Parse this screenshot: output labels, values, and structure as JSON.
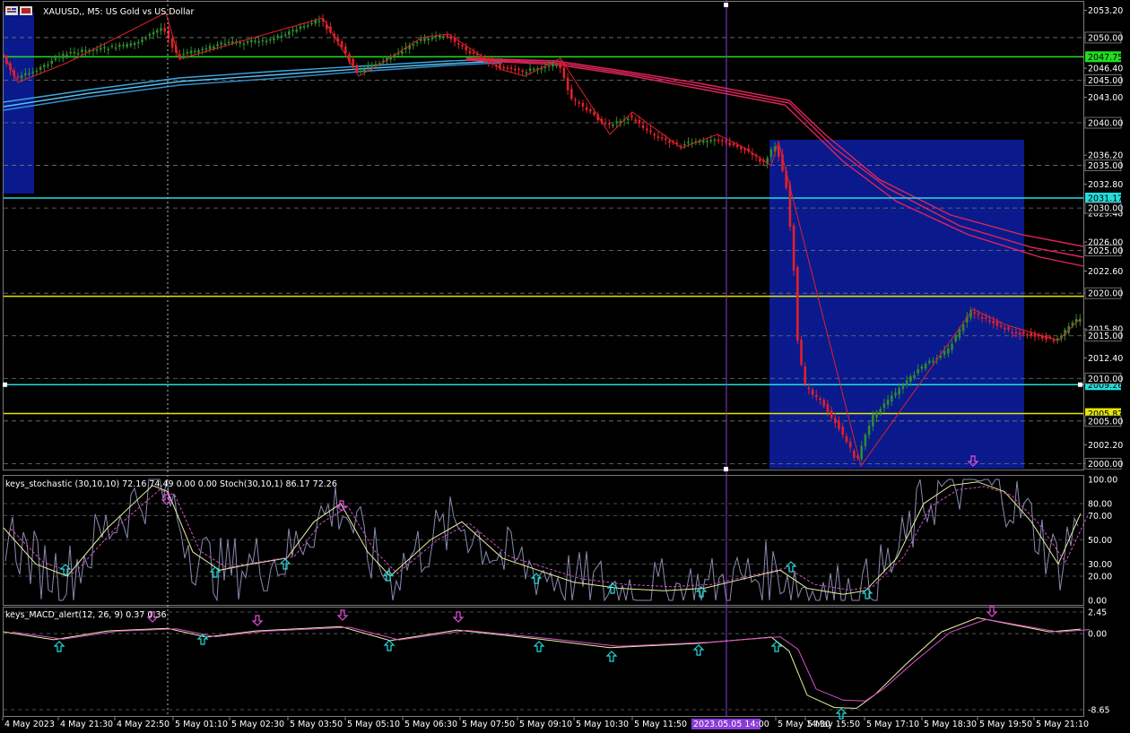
{
  "title": "XAUUSD,, M5:  US Gold vs US Dollar",
  "colors": {
    "background": "#000000",
    "bull": "#2e8b2e",
    "bear": "#e0202a",
    "zone": "#0a1a8c",
    "ema_red": "#e0245a",
    "ema_blue": "#3aa8e0",
    "green_level": "#22dd22",
    "cyan_level": "#22dddd",
    "yellow_level": "#e6e600",
    "crosshair": "#8a3ad8"
  },
  "price_axis": {
    "range": [
      1999.3,
      2054.2
    ],
    "ticks": [
      "2053.20",
      "2050.00",
      "2046.40",
      "2045.00",
      "2043.00",
      "2040.00",
      "2036.20",
      "2035.00",
      "2032.80",
      "2029.40",
      "2026.00",
      "2025.00",
      "2022.60",
      "2020.00",
      "2015.80",
      "2015.00",
      "2012.40",
      "2010.00",
      "2005.00",
      "2002.20",
      "2000.00"
    ],
    "tick_values": [
      2053.2,
      2050.0,
      2046.4,
      2045.0,
      2043.0,
      2040.0,
      2036.2,
      2035.0,
      2032.8,
      2029.4,
      2026.0,
      2025.0,
      2022.6,
      2020.0,
      2015.8,
      2015.0,
      2012.4,
      2010.0,
      2005.0,
      2002.2,
      2000.0
    ],
    "boxed": [
      "2050.00",
      "2045.00",
      "2040.00",
      "2035.00",
      "2030.00",
      "2025.00",
      "2020.00",
      "2015.00",
      "2010.00",
      "2005.00",
      "2000.00"
    ],
    "boxed_values": [
      2050,
      2045,
      2040,
      2035,
      2030,
      2025,
      2020,
      2015,
      2010,
      2005,
      2000
    ]
  },
  "levels": [
    {
      "value": 2047.75,
      "label": "2047.75",
      "color": "#22dd22",
      "text": "#000000"
    },
    {
      "value": 2031.17,
      "label": "2031.17",
      "color": "#22dddd",
      "text": "#000000"
    },
    {
      "value": 2019.64,
      "label": "",
      "color": "#e6e600",
      "text": "#000000"
    },
    {
      "value": 2009.26,
      "label": "2009.26",
      "color": "#22dddd",
      "text": "#000000"
    },
    {
      "value": 2005.87,
      "label": "2005.87",
      "color": "#e6e600",
      "text": "#000000"
    }
  ],
  "stochastic": {
    "label": "keys_stochastic (30,10,10) 72.16 74.49 0.00 0.00 Stoch(30,10,1) 86.17 72.26",
    "ticks": [
      "100.00",
      "80.00",
      "70.00",
      "50.00",
      "30.00",
      "20.00",
      "0.00"
    ],
    "tick_values": [
      100,
      80,
      70,
      50,
      30,
      20,
      0
    ]
  },
  "macd": {
    "label": "keys_MACD_alert(12, 26, 9) 0.37 0.36",
    "ticks": [
      "2.45",
      "0.00",
      "-8.65"
    ],
    "tick_values": [
      2.45,
      0,
      -8.65
    ]
  },
  "time_axis": {
    "labels": [
      "4 May 2023",
      "4 May 21:30",
      "4 May 22:50",
      "5 May 01:10",
      "5 May 02:30",
      "5 May 03:50",
      "5 May 05:10",
      "5 May 06:30",
      "5 May 07:50",
      "5 May 09:10",
      "5 May 10:30",
      "5 May 11:50",
      "5 May 14:30",
      "5 May 15:50",
      "5 May 17:10",
      "5 May 18:30",
      "5 May 19:50",
      "5 May 21:10"
    ],
    "crosshair_label": "2023.05.05 14:00"
  }
}
